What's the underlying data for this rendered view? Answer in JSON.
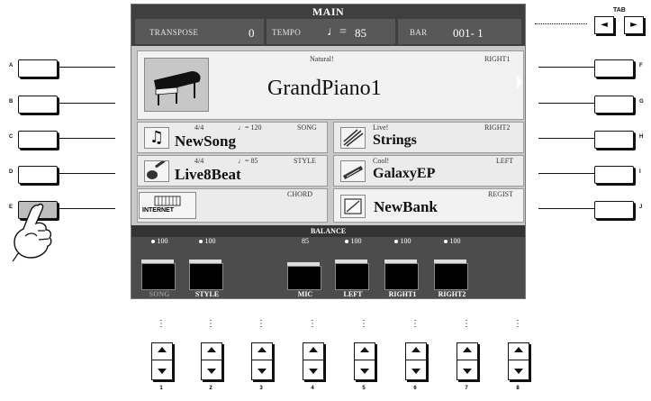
{
  "screen": {
    "title": "MAIN",
    "transpose": {
      "label": "TRANSPOSE",
      "value": "0"
    },
    "tempo": {
      "label": "TEMPO",
      "note": "♩=",
      "value": "85"
    },
    "bar": {
      "label": "BAR",
      "value": "001- 1"
    }
  },
  "right1": {
    "label": "RIGHT1",
    "category": "Natural!",
    "voice": "GrandPiano1"
  },
  "song": {
    "time_sig": "4/4",
    "tempo": "♩= 120",
    "label": "SONG",
    "name": "NewSong"
  },
  "style": {
    "time_sig": "4/4",
    "tempo": "♩= 85",
    "label": "STYLE",
    "name": "Live8Beat"
  },
  "chord": {
    "label": "CHORD",
    "internet": "INTERNET"
  },
  "right2": {
    "label": "RIGHT2",
    "category": "Live!",
    "voice": "Strings"
  },
  "left": {
    "label": "LEFT",
    "category": "Cool!",
    "voice": "GalaxyEP"
  },
  "regist": {
    "label": "REGIST",
    "bank": "NewBank"
  },
  "balance": {
    "title": "BALANCE",
    "channels": [
      {
        "name": "SONG",
        "value": "100"
      },
      {
        "name": "STYLE",
        "value": "100"
      },
      {
        "name": "MIC",
        "value": "85"
      },
      {
        "name": "LEFT",
        "value": "100"
      },
      {
        "name": "RIGHT1",
        "value": "100"
      },
      {
        "name": "RIGHT2",
        "value": "100"
      }
    ]
  },
  "left_buttons": [
    "A",
    "B",
    "C",
    "D",
    "E"
  ],
  "right_buttons": [
    "F",
    "G",
    "H",
    "I",
    "J"
  ],
  "tab": {
    "label": "TAB",
    "left": "◄",
    "right": "►"
  },
  "steppers": [
    "1",
    "2",
    "3",
    "4",
    "5",
    "6",
    "7",
    "8"
  ],
  "dots": "⋮"
}
